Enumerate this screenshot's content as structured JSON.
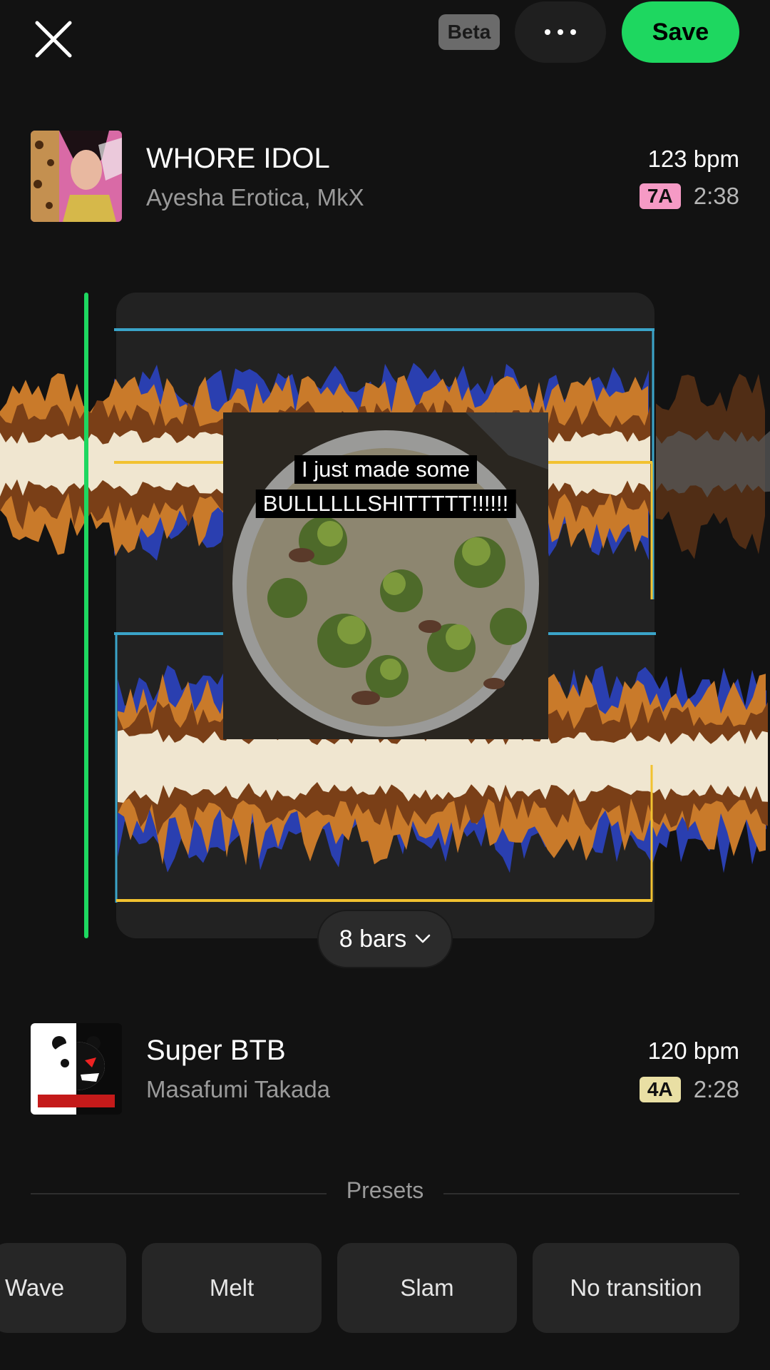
{
  "header": {
    "beta_label": "Beta",
    "save_label": "Save"
  },
  "track_top": {
    "title": "WHORE IDOL",
    "artist": "Ayesha Erotica, MkX",
    "bpm": "123 bpm",
    "key": "7A",
    "duration": "2:38",
    "key_color": "#f59ac5"
  },
  "track_bottom": {
    "title": "Super BTB",
    "artist": "Masafumi Takada",
    "bpm": "120 bpm",
    "key": "4A",
    "duration": "2:28",
    "key_color": "#e9dfa4"
  },
  "transition": {
    "length_label": "8 bars"
  },
  "video_overlay": {
    "caption_line1": "I just made some",
    "caption_line2": "BULLLLLLSHITTTTT!!!!!!"
  },
  "presets": {
    "label": "Presets",
    "items": [
      "Wave",
      "Melt",
      "Slam",
      "No transition"
    ]
  },
  "colors": {
    "accent": "#1ed760",
    "marker_blue": "#3aa4c9",
    "marker_yellow": "#f2c230",
    "wave_orange": "#c97a2a",
    "wave_brown": "#7a3f17",
    "wave_cream": "#f0e6d0",
    "wave_blue": "#2a3fb0"
  }
}
